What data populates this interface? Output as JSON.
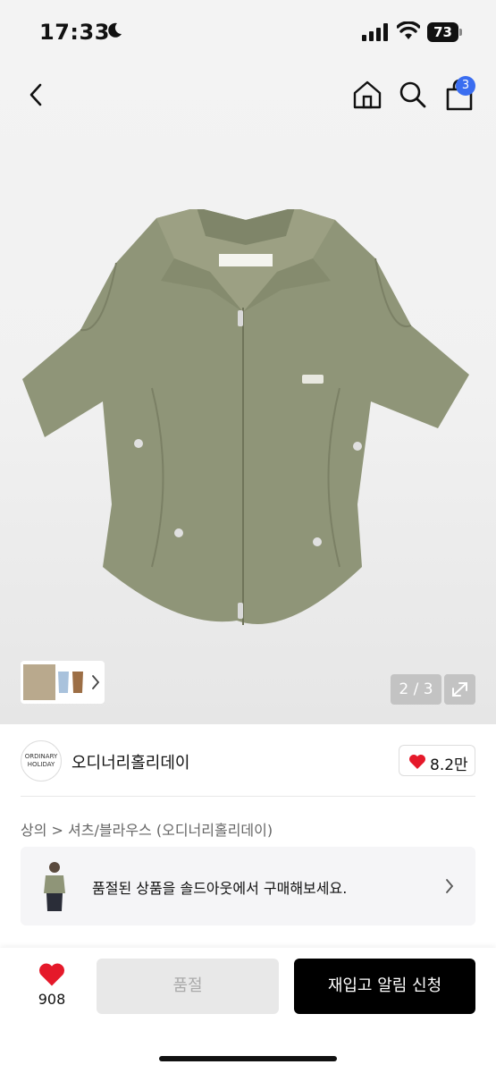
{
  "status_bar": {
    "time": "17:33",
    "battery": "73"
  },
  "header": {
    "cart_count": "3"
  },
  "gallery": {
    "counter": "2 / 3"
  },
  "brand": {
    "logo_line1": "ORDINARY",
    "logo_line2": "HOLIDAY",
    "name": "오디너리홀리데이",
    "likes": "8.2만"
  },
  "breadcrumb": {
    "category": "상의",
    "separator": ">",
    "subcategory": "셔츠/블라우스",
    "brand_suffix": "(오디너리홀리데이)"
  },
  "soldout_banner": {
    "text": "품절된 상품을 솔드아웃에서 구매해보세요."
  },
  "bottom_bar": {
    "wish_count": "908",
    "soldout_label": "품절",
    "restock_label": "재입고 알림 신청"
  },
  "colors": {
    "accent_blue": "#3a6df0",
    "heart_red": "#e5192a",
    "shirt_olive": "#8f9578",
    "button_black": "#000000"
  },
  "icons": [
    "moon-icon",
    "signal-icon",
    "wifi-icon",
    "back-icon",
    "home-icon",
    "search-icon",
    "cart-icon",
    "chevron-right-icon",
    "expand-icon",
    "heart-icon"
  ]
}
